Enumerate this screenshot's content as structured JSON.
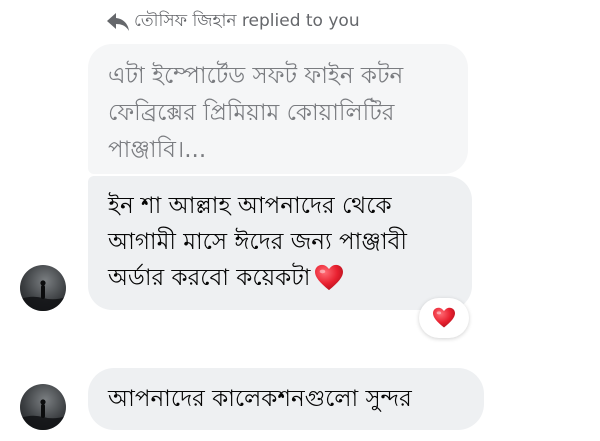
{
  "reply": {
    "header_text": "তৌসিফ জিহান replied to you",
    "icon": "reply-arrow-icon"
  },
  "quoted_message": {
    "text": "এটা ইম্পোর্টেড সফট ফাইন কটন ফেব্রিক্সের প্রিমিয়াম কোয়ালিটির পাঞ্জাবি।..."
  },
  "main_message": {
    "text": "ইন শা আল্লাহ আপনাদের থেকে আগামী মাসে ঈদের জন্য পাঞ্জাবী অর্ডার করবো কয়েকটা",
    "emoji": "heart-icon"
  },
  "reaction": {
    "emoji": "heart-icon"
  },
  "second_message": {
    "text": "আপনাদের কালেকশনগুলো সুন্দর"
  },
  "colors": {
    "heart": "#e8202f",
    "secondary_text": "#65676b",
    "bubble": "#eef0f2"
  }
}
